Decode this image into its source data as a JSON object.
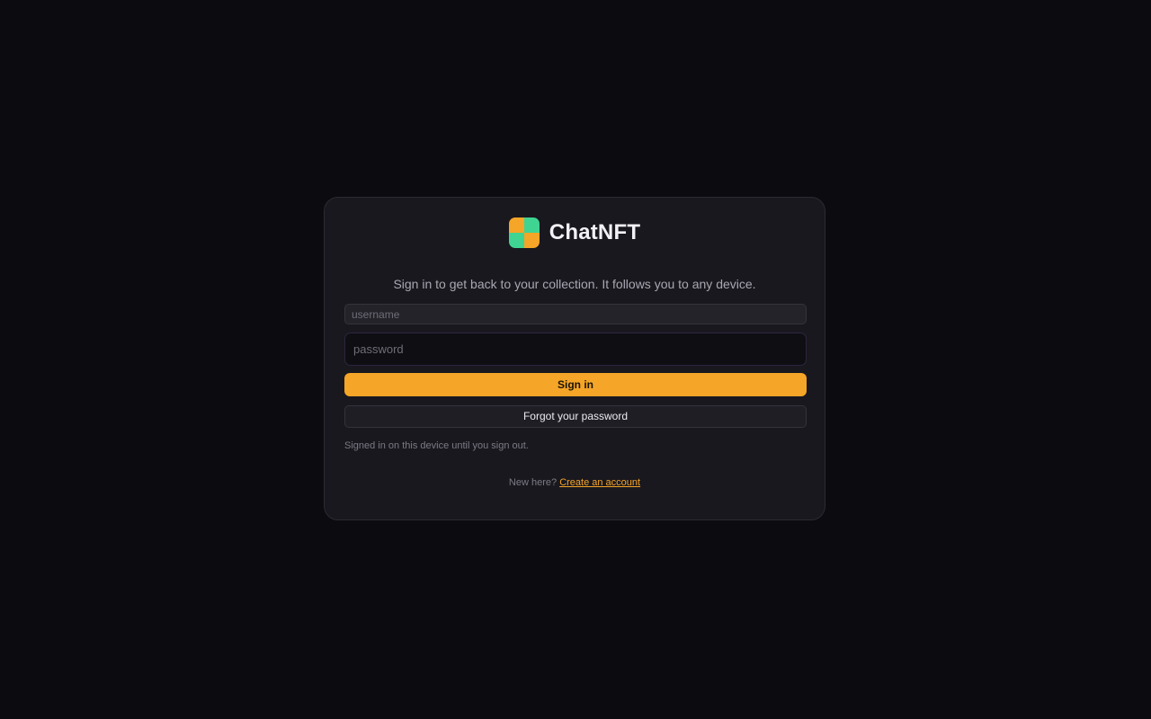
{
  "brand": {
    "name": "ChatNFT",
    "logo_colors": [
      "#f5a527",
      "#3fd492"
    ]
  },
  "login": {
    "subtitle": "Sign in to get back to your collection. It follows you to any device.",
    "username_placeholder": "username",
    "password_placeholder": "password",
    "signin_label": "Sign in",
    "forgot_label": "Forgot your password",
    "session_note": "Signed in on this device until you sign out.",
    "register_prompt": "New here?",
    "register_link": "Create an account"
  },
  "colors": {
    "background": "#0c0b10",
    "card": "#19181f",
    "accent": "#f5a527"
  }
}
